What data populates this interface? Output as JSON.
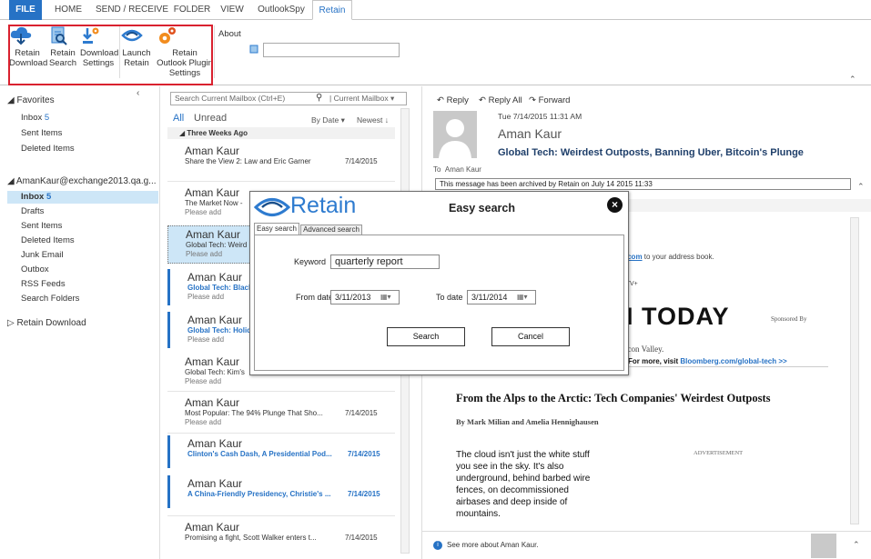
{
  "ribbon_tabs": [
    "FILE",
    "HOME",
    "SEND / RECEIVE",
    "FOLDER",
    "VIEW",
    "OutlookSpy",
    "Retain"
  ],
  "ribbon": {
    "retain_download": "Retain Download",
    "retain_search": "Retain Search",
    "download_settings": "Download Settings",
    "launch_retain": "Launch Retain",
    "plugin_settings": "Retain Outlook Plugin Settings",
    "about": "About"
  },
  "folders": {
    "favorites": "Favorites",
    "fav_items": [
      {
        "label": "Inbox",
        "count": "5"
      },
      {
        "label": "Sent Items",
        "count": ""
      },
      {
        "label": "Deleted Items",
        "count": ""
      }
    ],
    "account": "AmanKaur@exchange2013.qa.g...",
    "account_items": [
      {
        "label": "Inbox",
        "count": "5"
      },
      {
        "label": "Drafts",
        "count": ""
      },
      {
        "label": "Sent Items",
        "count": ""
      },
      {
        "label": "Deleted Items",
        "count": ""
      },
      {
        "label": "Junk Email",
        "count": ""
      },
      {
        "label": "Outbox",
        "count": ""
      },
      {
        "label": "RSS Feeds",
        "count": ""
      },
      {
        "label": "Search Folders",
        "count": ""
      }
    ],
    "retain_download": "Retain Download"
  },
  "list": {
    "search_placeholder": "Search Current Mailbox (Ctrl+E)",
    "scope": "Current Mailbox",
    "filter_all": "All",
    "filter_unread": "Unread",
    "sort_by": "By Date",
    "sort_order": "Newest",
    "group": "Three Weeks Ago",
    "messages": [
      {
        "sender": "Aman Kaur",
        "subject": "Share the View 2: Law and Eric Garner",
        "preview": "",
        "date": "7/14/2015"
      },
      {
        "sender": "Aman Kaur",
        "subject": "The Market Now -",
        "preview": "Please add",
        "date": ""
      },
      {
        "sender": "Aman Kaur",
        "subject": "Global Tech: Weird",
        "preview": "Please add",
        "date": ""
      },
      {
        "sender": "Aman Kaur",
        "subject": "Global Tech: Black",
        "preview": "Please add",
        "date": ""
      },
      {
        "sender": "Aman Kaur",
        "subject": "Global Tech: Holid",
        "preview": "Please add",
        "date": ""
      },
      {
        "sender": "Aman Kaur",
        "subject": "Global Tech: Kim's",
        "preview": "Please add",
        "date": ""
      },
      {
        "sender": "Aman Kaur",
        "subject": "Most Popular: The 94% Plunge That Sho...",
        "preview": "Please add",
        "date": "7/14/2015"
      },
      {
        "sender": "Aman Kaur",
        "subject": "Clinton's Cash Dash, A Presidential Pod...",
        "preview": "",
        "date": "7/14/2015"
      },
      {
        "sender": "Aman Kaur",
        "subject": "A China-Friendly Presidency, Christie's ...",
        "preview": "",
        "date": "7/14/2015"
      },
      {
        "sender": "Aman Kaur",
        "subject": "Promising a fight, Scott Walker enters t...",
        "preview": "",
        "date": "7/14/2015"
      }
    ]
  },
  "reading": {
    "reply": "Reply",
    "reply_all": "Reply All",
    "forward": "Forward",
    "datetime": "Tue 7/14/2015 11:31 AM",
    "sender": "Aman Kaur",
    "subject": "Global Tech: Weirdest Outposts, Banning Uber, Bitcoin's Plunge",
    "to_label": "To",
    "to_value": "Aman Kaur",
    "archived_notice": "This message has been archived by Retain on July 14 2015 11:33",
    "addr_link": "g.com",
    "addr_text": " to your address book.",
    "g_tv": "g TV+",
    "today": "H TODAY",
    "sponsored": "Sponsored By",
    "silicon": "ilicon Valley.",
    "more_visit": "For more, visit ",
    "more_link": "Bloomberg.com/global-tech >>",
    "headline": "From the Alps to the Arctic: Tech Companies' Weirdest Outposts",
    "byline": "By Mark Milian and Amelia Hennighausen",
    "body_lines": [
      "The cloud isn't just the white stuff",
      "you see in the sky. It's also",
      "underground, behind barbed wire",
      "fences, on decommissioned",
      "airbases and deep inside of",
      "mountains."
    ],
    "advertisement": "ADVERTISEMENT",
    "see_more": "See more about Aman Kaur."
  },
  "dialog": {
    "logo": "Retain",
    "title": "Easy search",
    "tab_easy": "Easy search",
    "tab_advanced": "Advanced search",
    "keyword_label": "Keyword",
    "keyword_value": "quarterly report",
    "from_label": "From date",
    "from_value": "3/11/2013",
    "to_label": "To date",
    "to_value": "3/11/2014",
    "search_button": "Search",
    "cancel_button": "Cancel"
  }
}
